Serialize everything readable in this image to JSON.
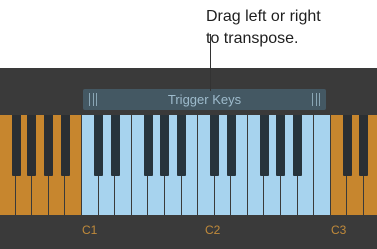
{
  "callout": {
    "line1": "Drag left or right",
    "line2": "to transpose."
  },
  "trigger_range": {
    "label": "Trigger Keys",
    "color": "#445863",
    "text_color": "#9ebbcc"
  },
  "keyboard": {
    "octave_labels": [
      "C1",
      "C2",
      "C3"
    ],
    "colors": {
      "white_outside": "#c7862e",
      "white_inside": "#a7d3ee",
      "black": "#2b2f33"
    }
  }
}
